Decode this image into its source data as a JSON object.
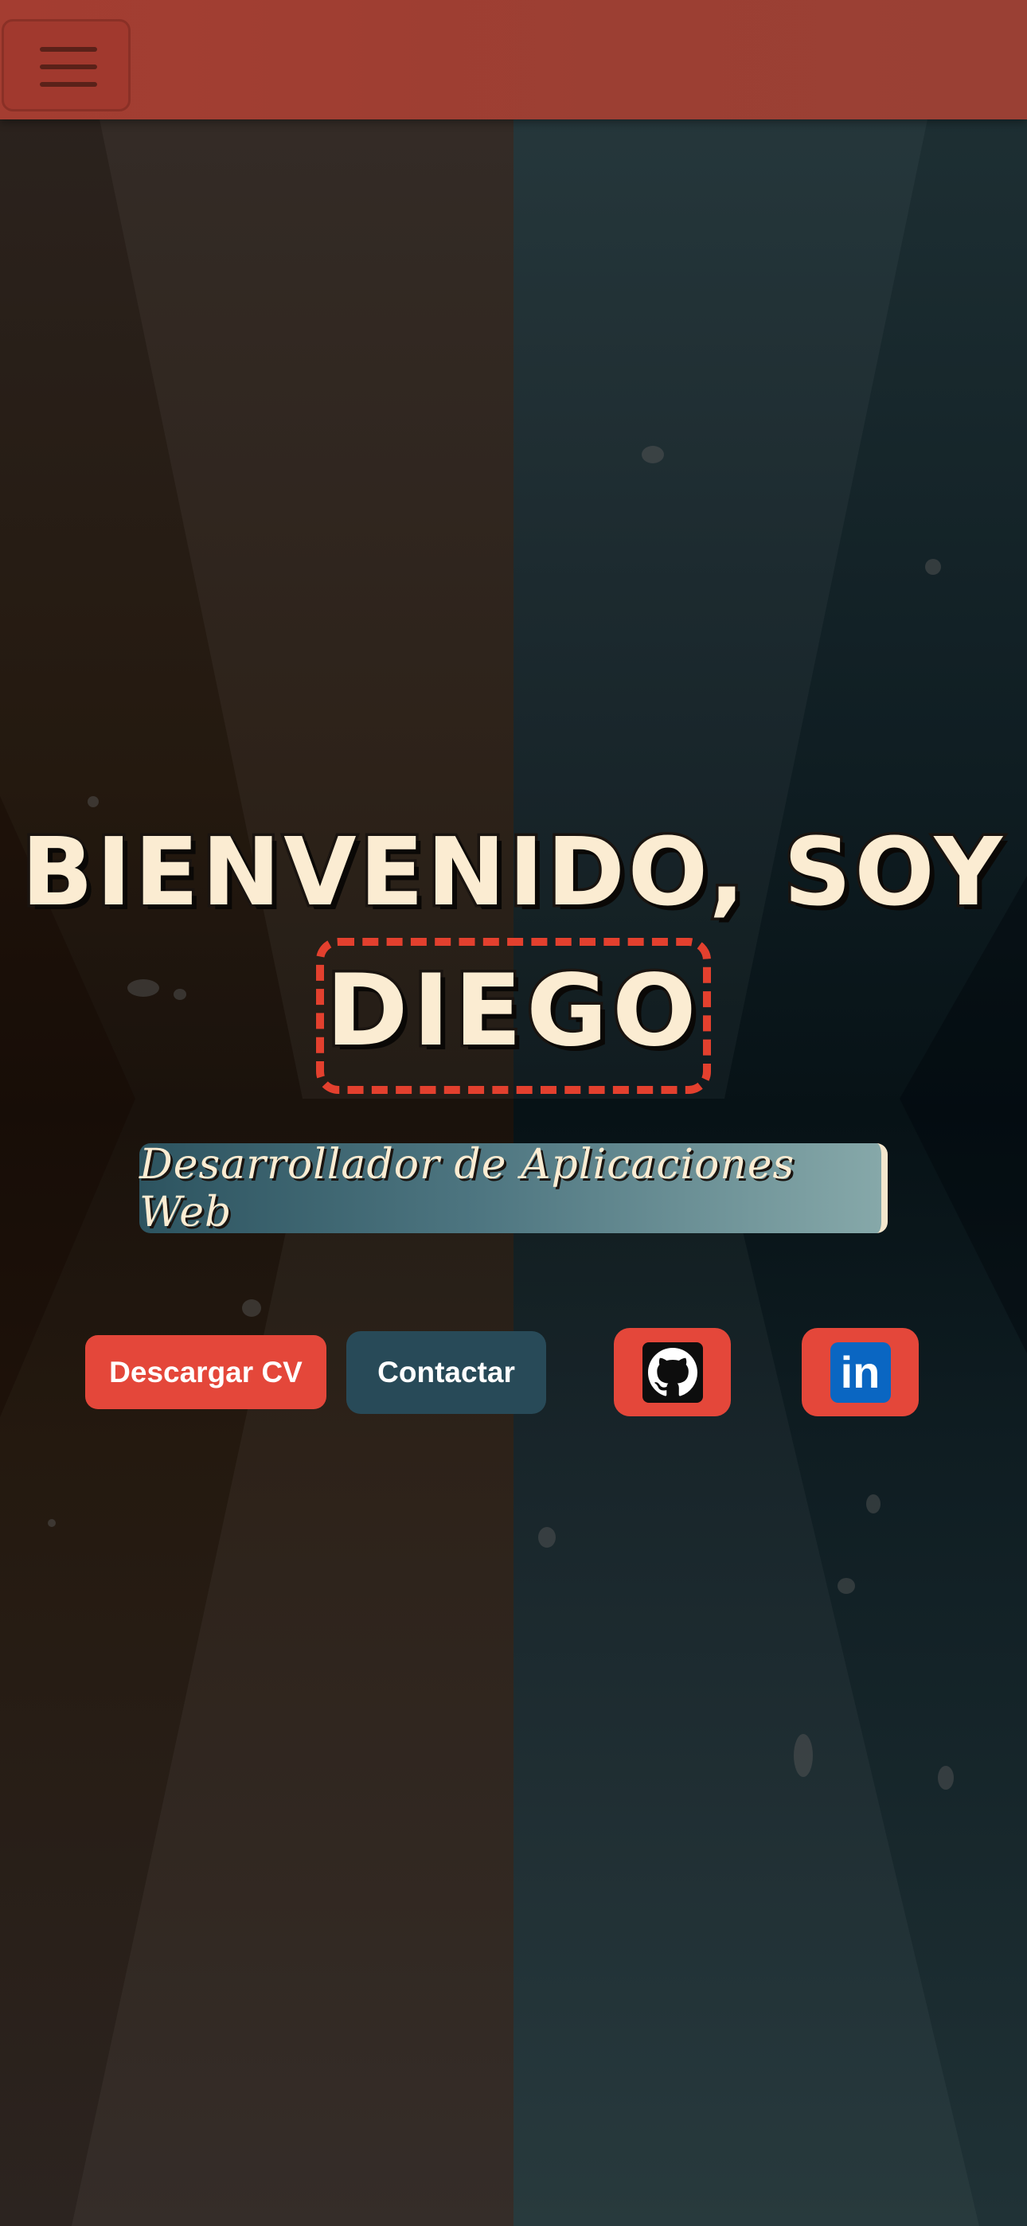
{
  "header": {
    "menu_icon": "hamburger-menu-icon"
  },
  "hero": {
    "greeting": "BIENVENIDO, SOY",
    "name": "DIEGO",
    "subtitle": "Desarrollador de Aplicaciones Web"
  },
  "actions": {
    "download_cv_label": "Descargar CV",
    "contact_label": "Contactar"
  },
  "social": {
    "github_icon": "github-icon",
    "linkedin_icon": "linkedin-icon",
    "linkedin_glyph": "in"
  },
  "colors": {
    "accent_red": "#e4473a",
    "header_red": "#a43d31",
    "teal_button": "#284a58",
    "cream_text": "#fbecd2",
    "linkedin_blue": "#0a66c2"
  }
}
